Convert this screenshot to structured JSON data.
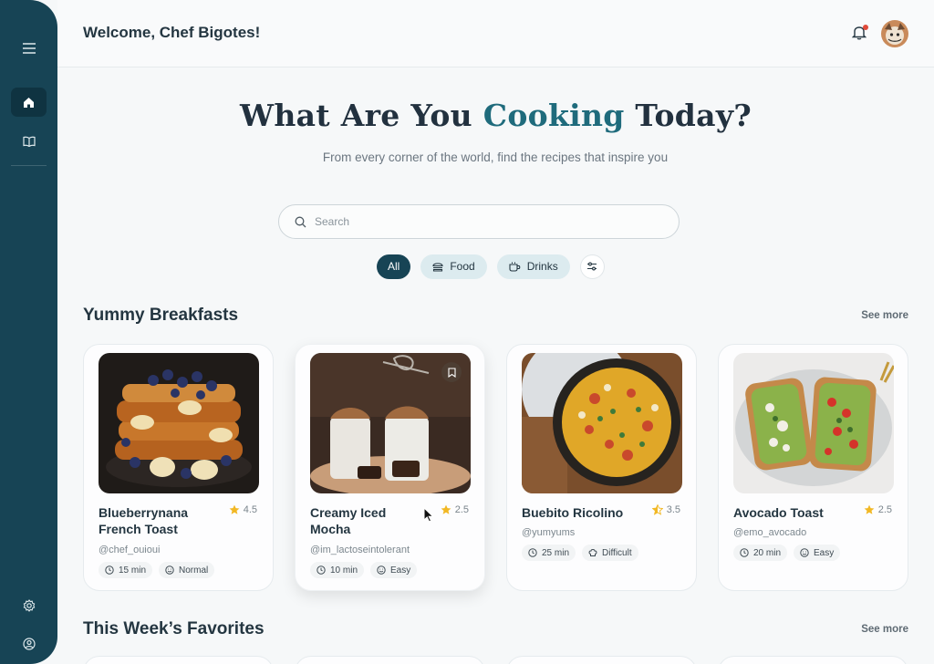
{
  "header": {
    "welcome": "Welcome, Chef Bigotes!"
  },
  "sidebar": {
    "items": [
      {
        "icon": "menu-icon"
      },
      {
        "icon": "home-icon",
        "active": true
      },
      {
        "icon": "book-icon"
      },
      {
        "icon": "settings-icon"
      },
      {
        "icon": "profile-icon"
      }
    ]
  },
  "hero": {
    "title_before": "What Are You ",
    "title_accent": "Cooking",
    "title_after": " Today?",
    "subtitle": "From every corner of the world, find the recipes that inspire you"
  },
  "search": {
    "placeholder": "Search"
  },
  "filters": [
    {
      "label": "All",
      "active": true
    },
    {
      "label": "Food",
      "icon": "burger-icon"
    },
    {
      "label": "Drinks",
      "icon": "mug-icon"
    }
  ],
  "sections": [
    {
      "title": "Yummy Breakfasts",
      "see_more": "See more"
    },
    {
      "title": "This Week’s Favorites",
      "see_more": "See more"
    }
  ],
  "breakfasts": [
    {
      "name": "Blueberrynana French Toast",
      "rating": "4.5",
      "author": "@chef_ouioui",
      "time": "15 min",
      "level": "Normal"
    },
    {
      "name": "Creamy Iced Mocha",
      "rating": "2.5",
      "author": "@im_lactoseintolerant",
      "time": "10 min",
      "level": "Easy"
    },
    {
      "name": "Buebito Ricolino",
      "rating": "3.5",
      "author": "@yumyums",
      "time": "25 min",
      "level": "Difficult"
    },
    {
      "name": "Avocado Toast",
      "rating": "2.5",
      "author": "@emo_avocado",
      "time": "20 min",
      "level": "Easy"
    }
  ],
  "colors": {
    "sidebar": "#174455",
    "accent": "#1f6b7c",
    "star": "#f2b824"
  }
}
